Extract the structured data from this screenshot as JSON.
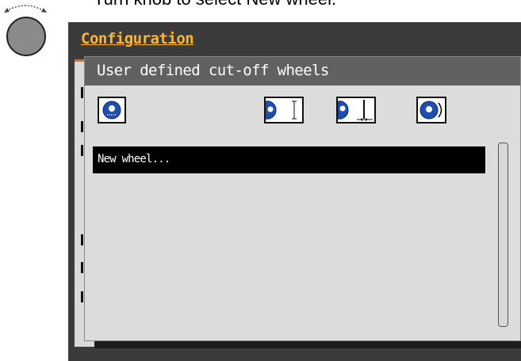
{
  "instruction": "Turn knob to select New wheel.",
  "knob": {
    "icon": "rotary-knob-icon"
  },
  "background_window": {
    "title": "Configuration"
  },
  "dialog": {
    "title": "User defined cut-off wheels",
    "toolbar": [
      {
        "name": "wheel-select-icon"
      },
      {
        "name": "wheel-diameter-icon"
      },
      {
        "name": "wheel-thickness-icon"
      },
      {
        "name": "wheel-rotation-icon"
      }
    ],
    "list": [
      {
        "label": "New wheel...",
        "selected": true
      }
    ]
  },
  "colors": {
    "screen_bg": "#3b3b3b",
    "title_accent": "#ffb432",
    "header_bar": "#616161",
    "panel": "#dcdcdc",
    "selection": "#000000"
  }
}
